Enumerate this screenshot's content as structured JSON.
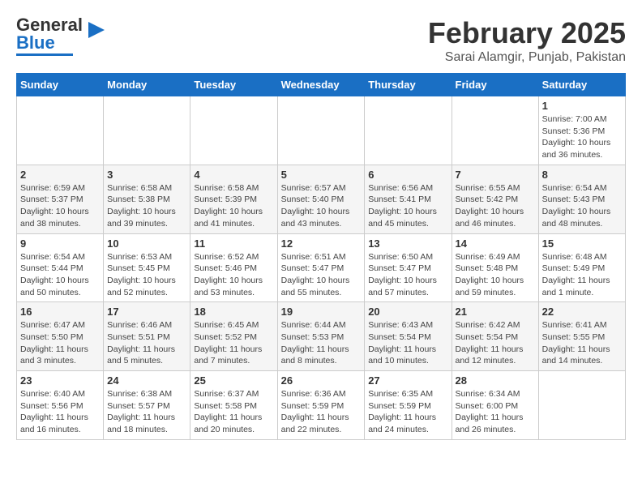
{
  "header": {
    "logo_general": "General",
    "logo_blue": "Blue",
    "month_title": "February 2025",
    "location": "Sarai Alamgir, Punjab, Pakistan"
  },
  "calendar": {
    "days_of_week": [
      "Sunday",
      "Monday",
      "Tuesday",
      "Wednesday",
      "Thursday",
      "Friday",
      "Saturday"
    ],
    "weeks": [
      [
        {
          "day": "",
          "info": ""
        },
        {
          "day": "",
          "info": ""
        },
        {
          "day": "",
          "info": ""
        },
        {
          "day": "",
          "info": ""
        },
        {
          "day": "",
          "info": ""
        },
        {
          "day": "",
          "info": ""
        },
        {
          "day": "1",
          "info": "Sunrise: 7:00 AM\nSunset: 5:36 PM\nDaylight: 10 hours\nand 36 minutes."
        }
      ],
      [
        {
          "day": "2",
          "info": "Sunrise: 6:59 AM\nSunset: 5:37 PM\nDaylight: 10 hours\nand 38 minutes."
        },
        {
          "day": "3",
          "info": "Sunrise: 6:58 AM\nSunset: 5:38 PM\nDaylight: 10 hours\nand 39 minutes."
        },
        {
          "day": "4",
          "info": "Sunrise: 6:58 AM\nSunset: 5:39 PM\nDaylight: 10 hours\nand 41 minutes."
        },
        {
          "day": "5",
          "info": "Sunrise: 6:57 AM\nSunset: 5:40 PM\nDaylight: 10 hours\nand 43 minutes."
        },
        {
          "day": "6",
          "info": "Sunrise: 6:56 AM\nSunset: 5:41 PM\nDaylight: 10 hours\nand 45 minutes."
        },
        {
          "day": "7",
          "info": "Sunrise: 6:55 AM\nSunset: 5:42 PM\nDaylight: 10 hours\nand 46 minutes."
        },
        {
          "day": "8",
          "info": "Sunrise: 6:54 AM\nSunset: 5:43 PM\nDaylight: 10 hours\nand 48 minutes."
        }
      ],
      [
        {
          "day": "9",
          "info": "Sunrise: 6:54 AM\nSunset: 5:44 PM\nDaylight: 10 hours\nand 50 minutes."
        },
        {
          "day": "10",
          "info": "Sunrise: 6:53 AM\nSunset: 5:45 PM\nDaylight: 10 hours\nand 52 minutes."
        },
        {
          "day": "11",
          "info": "Sunrise: 6:52 AM\nSunset: 5:46 PM\nDaylight: 10 hours\nand 53 minutes."
        },
        {
          "day": "12",
          "info": "Sunrise: 6:51 AM\nSunset: 5:47 PM\nDaylight: 10 hours\nand 55 minutes."
        },
        {
          "day": "13",
          "info": "Sunrise: 6:50 AM\nSunset: 5:47 PM\nDaylight: 10 hours\nand 57 minutes."
        },
        {
          "day": "14",
          "info": "Sunrise: 6:49 AM\nSunset: 5:48 PM\nDaylight: 10 hours\nand 59 minutes."
        },
        {
          "day": "15",
          "info": "Sunrise: 6:48 AM\nSunset: 5:49 PM\nDaylight: 11 hours\nand 1 minute."
        }
      ],
      [
        {
          "day": "16",
          "info": "Sunrise: 6:47 AM\nSunset: 5:50 PM\nDaylight: 11 hours\nand 3 minutes."
        },
        {
          "day": "17",
          "info": "Sunrise: 6:46 AM\nSunset: 5:51 PM\nDaylight: 11 hours\nand 5 minutes."
        },
        {
          "day": "18",
          "info": "Sunrise: 6:45 AM\nSunset: 5:52 PM\nDaylight: 11 hours\nand 7 minutes."
        },
        {
          "day": "19",
          "info": "Sunrise: 6:44 AM\nSunset: 5:53 PM\nDaylight: 11 hours\nand 8 minutes."
        },
        {
          "day": "20",
          "info": "Sunrise: 6:43 AM\nSunset: 5:54 PM\nDaylight: 11 hours\nand 10 minutes."
        },
        {
          "day": "21",
          "info": "Sunrise: 6:42 AM\nSunset: 5:54 PM\nDaylight: 11 hours\nand 12 minutes."
        },
        {
          "day": "22",
          "info": "Sunrise: 6:41 AM\nSunset: 5:55 PM\nDaylight: 11 hours\nand 14 minutes."
        }
      ],
      [
        {
          "day": "23",
          "info": "Sunrise: 6:40 AM\nSunset: 5:56 PM\nDaylight: 11 hours\nand 16 minutes."
        },
        {
          "day": "24",
          "info": "Sunrise: 6:38 AM\nSunset: 5:57 PM\nDaylight: 11 hours\nand 18 minutes."
        },
        {
          "day": "25",
          "info": "Sunrise: 6:37 AM\nSunset: 5:58 PM\nDaylight: 11 hours\nand 20 minutes."
        },
        {
          "day": "26",
          "info": "Sunrise: 6:36 AM\nSunset: 5:59 PM\nDaylight: 11 hours\nand 22 minutes."
        },
        {
          "day": "27",
          "info": "Sunrise: 6:35 AM\nSunset: 5:59 PM\nDaylight: 11 hours\nand 24 minutes."
        },
        {
          "day": "28",
          "info": "Sunrise: 6:34 AM\nSunset: 6:00 PM\nDaylight: 11 hours\nand 26 minutes."
        },
        {
          "day": "",
          "info": ""
        }
      ]
    ]
  }
}
